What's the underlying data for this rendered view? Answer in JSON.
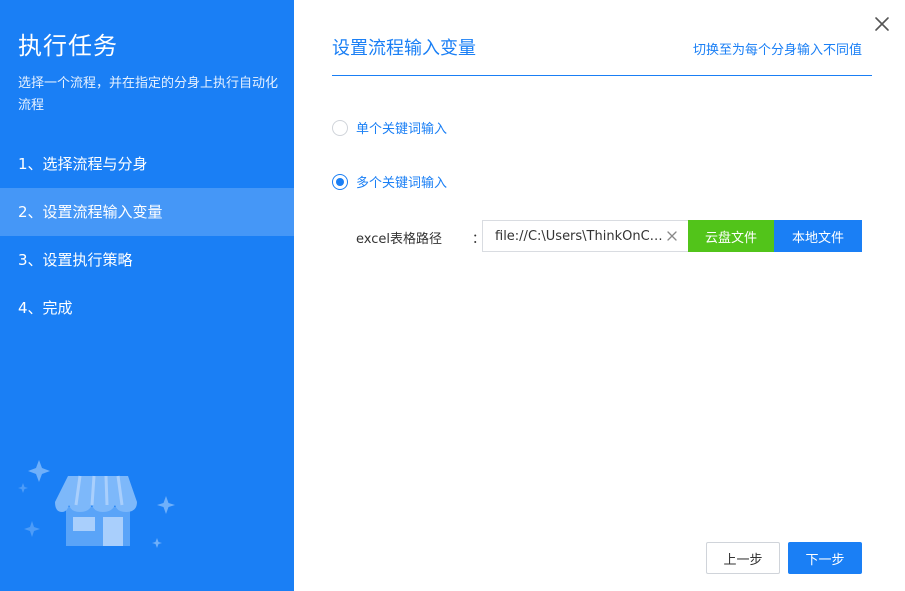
{
  "sidebar": {
    "title": "执行任务",
    "description": "选择一个流程，并在指定的分身上执行自动化流程",
    "steps": [
      {
        "label": "1、选择流程与分身"
      },
      {
        "label": "2、设置流程输入变量"
      },
      {
        "label": "3、设置执行策略"
      },
      {
        "label": "4、完成"
      }
    ],
    "active_step": 2
  },
  "main": {
    "title": "设置流程输入变量",
    "switch_link": "切换至为每个分身输入不同值",
    "options": [
      {
        "label": "单个关键词输入",
        "checked": false
      },
      {
        "label": "多个关键词输入",
        "checked": true
      }
    ],
    "excel_field": {
      "label": "excel表格路径",
      "colon": "：",
      "value": "file://C:\\Users\\ThinkOnClo..."
    },
    "cloud_button": "云盘文件",
    "local_button": "本地文件"
  },
  "footer": {
    "prev_button": "上一步",
    "next_button": "下一步"
  },
  "colors": {
    "primary": "#1a7ff5",
    "active_step_bg": "#4597f7",
    "cloud_button": "#52c41a"
  },
  "icons": {
    "close": "close-icon",
    "clear": "clear-icon",
    "illustration": "store-illustration"
  }
}
